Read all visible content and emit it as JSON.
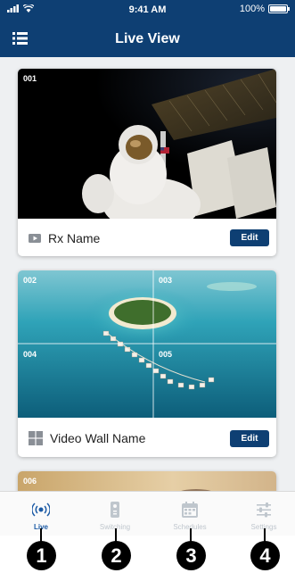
{
  "status_bar": {
    "time": "9:41 AM",
    "battery": "100%",
    "battery_level": 1.0
  },
  "header": {
    "title": "Live View"
  },
  "cards": [
    {
      "tile_numbers": [
        "001"
      ],
      "name": "Rx Name",
      "edit_label": "Edit",
      "type_icon": "tv-icon"
    },
    {
      "tile_numbers": [
        "002",
        "003",
        "004",
        "005"
      ],
      "name": "Video Wall Name",
      "edit_label": "Edit",
      "type_icon": "grid-icon"
    },
    {
      "tile_numbers": [
        "006"
      ]
    }
  ],
  "tabs": [
    {
      "label": "Live",
      "icon": "broadcast-icon",
      "active": true
    },
    {
      "label": "Switching",
      "icon": "remote-icon",
      "active": false
    },
    {
      "label": "Schedules",
      "icon": "calendar-icon",
      "active": false
    },
    {
      "label": "Settings",
      "icon": "sliders-icon",
      "active": false
    }
  ],
  "callouts": [
    "1",
    "2",
    "3",
    "4"
  ],
  "colors": {
    "primary": "#0e3f73",
    "active_tab": "#1b5aa5",
    "inactive_tab": "#bfc6cd",
    "background": "#eef0f2"
  }
}
